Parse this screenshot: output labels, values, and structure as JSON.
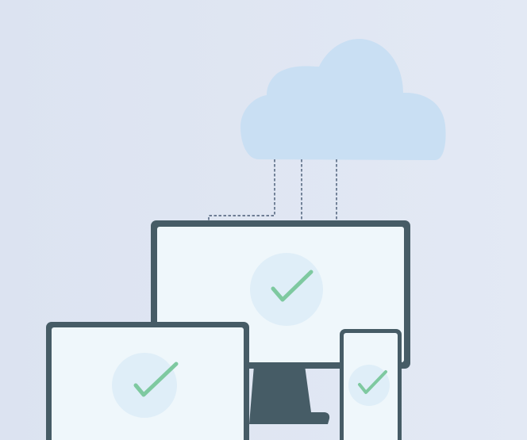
{
  "colors": {
    "background_start": "#dce3f1",
    "background_end": "#e3e9f4",
    "cloud": "#c9dff3",
    "device_frame": "#465c66",
    "screen": "#eff7fb",
    "check_circle": "#dfeef8",
    "checkmark": "#7ec9a0",
    "connector_line": "#2a3f5c"
  },
  "illustration": {
    "cloud": {
      "icon": "cloud-icon"
    },
    "devices": [
      {
        "type": "desktop-monitor",
        "status_icon": "checkmark-icon",
        "status": "synced"
      },
      {
        "type": "laptop",
        "status_icon": "checkmark-icon",
        "status": "synced"
      },
      {
        "type": "phone",
        "status_icon": "checkmark-icon",
        "status": "synced"
      }
    ]
  }
}
